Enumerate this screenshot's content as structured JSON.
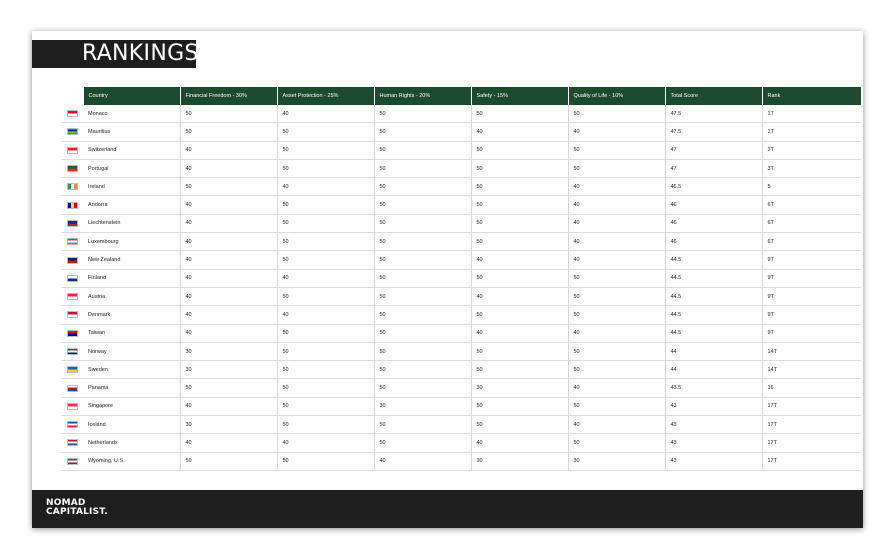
{
  "title": "RANKINGS",
  "logo": {
    "line1": "NOMAD",
    "line2": "CAPITALIST."
  },
  "columns": [
    "Country",
    "Financial Freedom - 30%",
    "Asset Protection - 25%",
    "Human Rights - 20%",
    "Safety - 15%",
    "Quality of Life - 10%",
    "Total Score",
    "Rank"
  ],
  "rows": [
    {
      "flag": "monaco-flag",
      "flag_colors": [
        "#e4002b",
        "#ffffff"
      ],
      "country": "Monaco",
      "ff": "50",
      "ap": "40",
      "hr": "50",
      "sf": "50",
      "ql": "50",
      "total": "47.5",
      "rank": "1T"
    },
    {
      "flag": "mauritius-flag",
      "flag_colors": [
        "#ea2839",
        "#1a206d",
        "#ffd500",
        "#00a551"
      ],
      "country": "Mauritius",
      "ff": "50",
      "ap": "50",
      "hr": "50",
      "sf": "40",
      "ql": "40",
      "total": "47.5",
      "rank": "1T"
    },
    {
      "flag": "switzerland-flag",
      "flag_colors": [
        "#d52b1e",
        "#ffffff"
      ],
      "country": "Switzerland",
      "ff": "40",
      "ap": "50",
      "hr": "50",
      "sf": "50",
      "ql": "50",
      "total": "47",
      "rank": "3T"
    },
    {
      "flag": "portugal-flag",
      "flag_colors": [
        "#046a38",
        "#da291c"
      ],
      "country": "Portugal",
      "ff": "40",
      "ap": "50",
      "hr": "50",
      "sf": "50",
      "ql": "50",
      "total": "47",
      "rank": "3T"
    },
    {
      "flag": "ireland-flag",
      "flag_colors": [
        "#169b62",
        "#ffffff",
        "#ff883e"
      ],
      "country": "Ireland",
      "ff": "50",
      "ap": "40",
      "hr": "50",
      "sf": "50",
      "ql": "40",
      "total": "46.5",
      "rank": "5"
    },
    {
      "flag": "andorra-flag",
      "flag_colors": [
        "#10069f",
        "#fedd00",
        "#d50032"
      ],
      "country": "Andorra",
      "ff": "40",
      "ap": "50",
      "hr": "50",
      "sf": "50",
      "ql": "40",
      "total": "46",
      "rank": "6T"
    },
    {
      "flag": "liechtenstein-flag",
      "flag_colors": [
        "#002b7f",
        "#ce1126"
      ],
      "country": "Liechtenstein",
      "ff": "40",
      "ap": "50",
      "hr": "50",
      "sf": "50",
      "ql": "40",
      "total": "46",
      "rank": "6T"
    },
    {
      "flag": "luxembourg-flag",
      "flag_colors": [
        "#ed2939",
        "#ffffff",
        "#00a1de"
      ],
      "country": "Luxembourg",
      "ff": "40",
      "ap": "50",
      "hr": "50",
      "sf": "50",
      "ql": "40",
      "total": "46",
      "rank": "6T"
    },
    {
      "flag": "new-zealand-flag",
      "flag_colors": [
        "#012169",
        "#c8102e"
      ],
      "country": "New Zealand",
      "ff": "40",
      "ap": "50",
      "hr": "50",
      "sf": "40",
      "ql": "40",
      "total": "44.5",
      "rank": "9T"
    },
    {
      "flag": "finland-flag",
      "flag_colors": [
        "#ffffff",
        "#003580"
      ],
      "country": "Finland",
      "ff": "40",
      "ap": "40",
      "hr": "50",
      "sf": "50",
      "ql": "50",
      "total": "44.5",
      "rank": "9T"
    },
    {
      "flag": "austria-flag",
      "flag_colors": [
        "#ed2939",
        "#ffffff"
      ],
      "country": "Austria",
      "ff": "40",
      "ap": "50",
      "hr": "50",
      "sf": "40",
      "ql": "50",
      "total": "44.5",
      "rank": "9T"
    },
    {
      "flag": "denmark-flag",
      "flag_colors": [
        "#c8102e",
        "#ffffff"
      ],
      "country": "Denmark",
      "ff": "40",
      "ap": "40",
      "hr": "50",
      "sf": "50",
      "ql": "50",
      "total": "44.5",
      "rank": "9T"
    },
    {
      "flag": "taiwan-flag",
      "flag_colors": [
        "#fe0000",
        "#000095"
      ],
      "country": "Taiwan",
      "ff": "40",
      "ap": "50",
      "hr": "50",
      "sf": "40",
      "ql": "40",
      "total": "44.5",
      "rank": "9T"
    },
    {
      "flag": "norway-flag",
      "flag_colors": [
        "#ba0c2f",
        "#ffffff",
        "#00205b"
      ],
      "country": "Norway",
      "ff": "30",
      "ap": "50",
      "hr": "50",
      "sf": "50",
      "ql": "50",
      "total": "44",
      "rank": "14T"
    },
    {
      "flag": "sweden-flag",
      "flag_colors": [
        "#006aa7",
        "#fecc00"
      ],
      "country": "Sweden",
      "ff": "30",
      "ap": "50",
      "hr": "50",
      "sf": "50",
      "ql": "50",
      "total": "44",
      "rank": "14T"
    },
    {
      "flag": "panama-flag",
      "flag_colors": [
        "#ffffff",
        "#d21034",
        "#005293"
      ],
      "country": "Panama",
      "ff": "50",
      "ap": "50",
      "hr": "50",
      "sf": "30",
      "ql": "40",
      "total": "43.5",
      "rank": "16"
    },
    {
      "flag": "singapore-flag",
      "flag_colors": [
        "#ef3340",
        "#ffffff"
      ],
      "country": "Singapore",
      "ff": "40",
      "ap": "50",
      "hr": "30",
      "sf": "50",
      "ql": "50",
      "total": "43",
      "rank": "17T"
    },
    {
      "flag": "iceland-flag",
      "flag_colors": [
        "#02529c",
        "#ffffff",
        "#dc1e35"
      ],
      "country": "Iceland",
      "ff": "30",
      "ap": "50",
      "hr": "50",
      "sf": "50",
      "ql": "40",
      "total": "43",
      "rank": "17T"
    },
    {
      "flag": "netherlands-flag",
      "flag_colors": [
        "#ae1c28",
        "#ffffff",
        "#21468b"
      ],
      "country": "Netherlands",
      "ff": "40",
      "ap": "40",
      "hr": "50",
      "sf": "40",
      "ql": "50",
      "total": "43",
      "rank": "17T"
    },
    {
      "flag": "usa-flag",
      "flag_colors": [
        "#b22234",
        "#ffffff",
        "#3c3b6e"
      ],
      "country": "Wyoming, U.S.",
      "ff": "50",
      "ap": "50",
      "hr": "40",
      "sf": "30",
      "ql": "30",
      "total": "43",
      "rank": "17T"
    }
  ]
}
